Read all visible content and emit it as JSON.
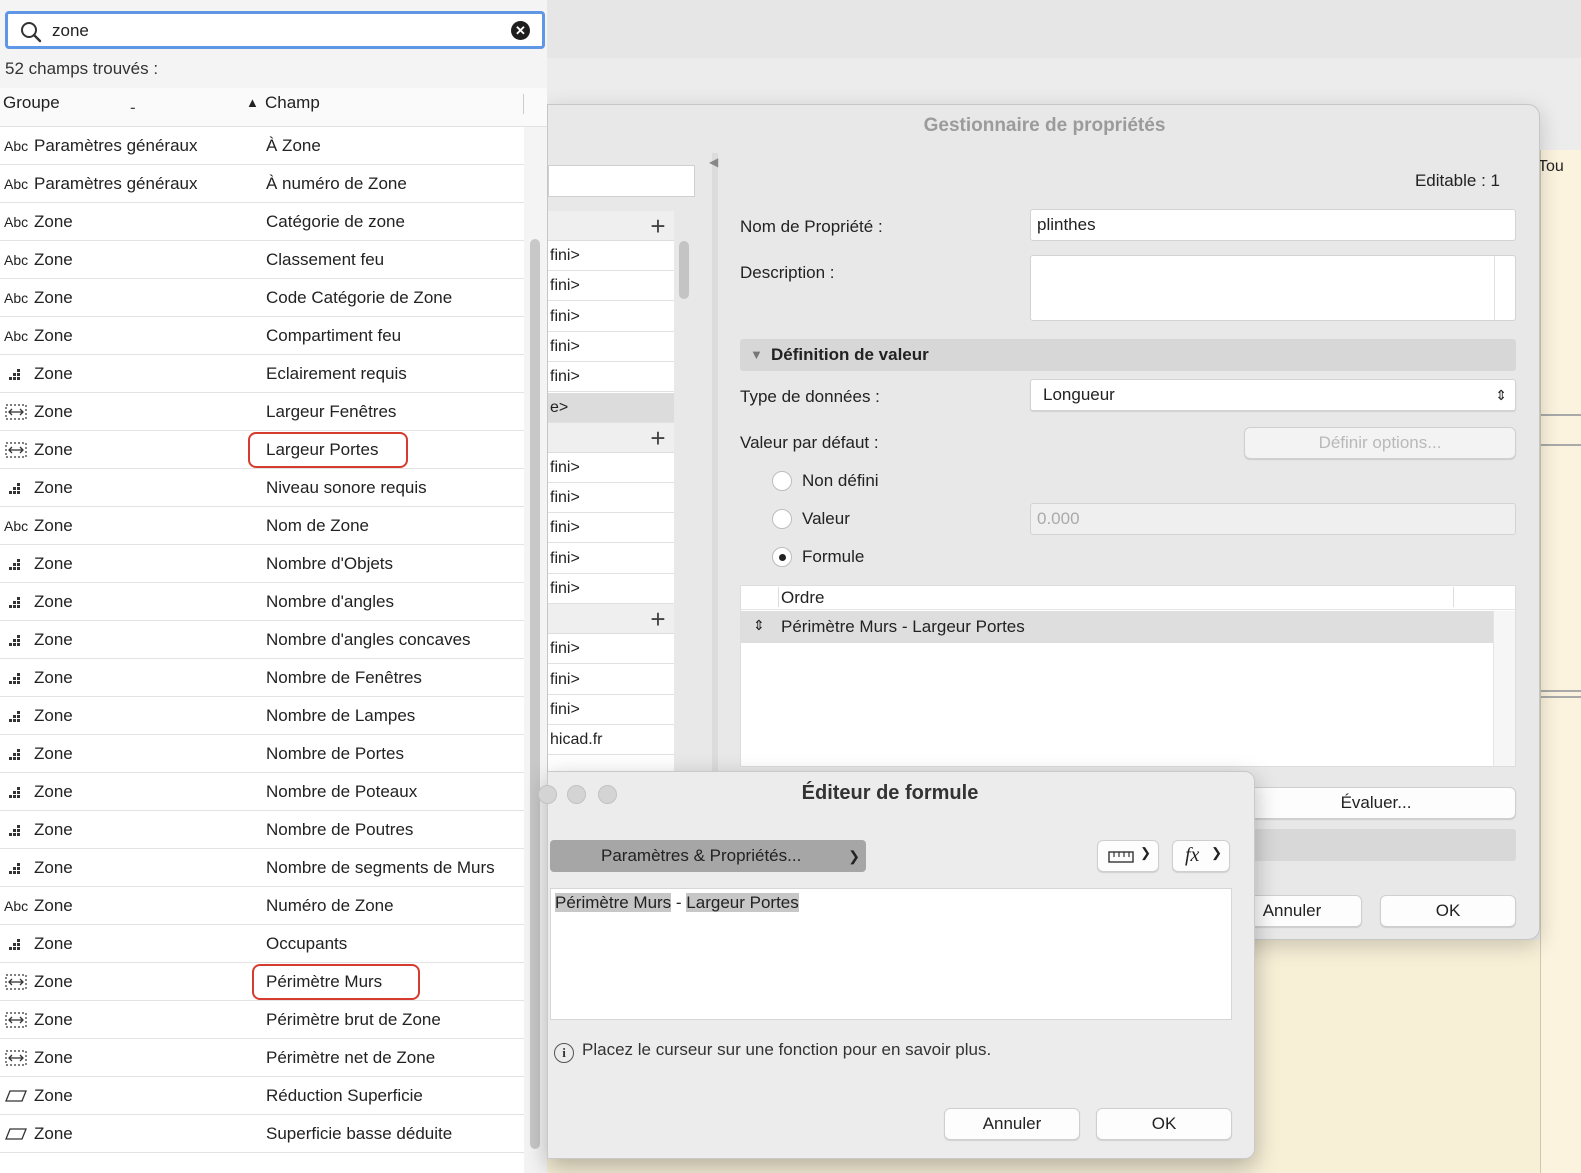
{
  "background": {
    "partial_label": "Tou"
  },
  "search_panel": {
    "search_value": "zone",
    "results_count": "52 champs trouvés :",
    "columns": {
      "group": "Groupe",
      "group_sub": "-",
      "field": "Champ",
      "sort": "▲"
    },
    "rows": [
      {
        "icon": "text",
        "group": "Paramètres généraux",
        "field": "À Zone"
      },
      {
        "icon": "text",
        "group": "Paramètres généraux",
        "field": "À numéro de Zone"
      },
      {
        "icon": "text",
        "group": "Zone",
        "field": "Catégorie de zone"
      },
      {
        "icon": "text",
        "group": "Zone",
        "field": "Classement feu"
      },
      {
        "icon": "text",
        "group": "Zone",
        "field": "Code Catégorie de Zone"
      },
      {
        "icon": "text",
        "group": "Zone",
        "field": "Compartiment feu"
      },
      {
        "icon": "number",
        "group": "Zone",
        "field": "Eclairement requis"
      },
      {
        "icon": "length",
        "group": "Zone",
        "field": "Largeur Fenêtres"
      },
      {
        "icon": "length",
        "group": "Zone",
        "field": "Largeur Portes",
        "highlight": true
      },
      {
        "icon": "number",
        "group": "Zone",
        "field": "Niveau sonore requis"
      },
      {
        "icon": "text",
        "group": "Zone",
        "field": "Nom de Zone"
      },
      {
        "icon": "number",
        "group": "Zone",
        "field": "Nombre d'Objets"
      },
      {
        "icon": "number",
        "group": "Zone",
        "field": "Nombre d'angles"
      },
      {
        "icon": "number",
        "group": "Zone",
        "field": "Nombre d'angles concaves"
      },
      {
        "icon": "number",
        "group": "Zone",
        "field": "Nombre de Fenêtres"
      },
      {
        "icon": "number",
        "group": "Zone",
        "field": "Nombre de Lampes"
      },
      {
        "icon": "number",
        "group": "Zone",
        "field": "Nombre de Portes"
      },
      {
        "icon": "number",
        "group": "Zone",
        "field": "Nombre de Poteaux"
      },
      {
        "icon": "number",
        "group": "Zone",
        "field": "Nombre de Poutres"
      },
      {
        "icon": "number",
        "group": "Zone",
        "field": "Nombre de segments de Murs"
      },
      {
        "icon": "text",
        "group": "Zone",
        "field": "Numéro de Zone"
      },
      {
        "icon": "number",
        "group": "Zone",
        "field": "Occupants"
      },
      {
        "icon": "length",
        "group": "Zone",
        "field": "Périmètre Murs",
        "highlight": true
      },
      {
        "icon": "length",
        "group": "Zone",
        "field": "Périmètre brut de Zone"
      },
      {
        "icon": "length",
        "group": "Zone",
        "field": "Périmètre net de Zone"
      },
      {
        "icon": "area",
        "group": "Zone",
        "field": "Réduction Superficie"
      },
      {
        "icon": "area",
        "group": "Zone",
        "field": "Superficie basse déduite"
      }
    ]
  },
  "property_manager": {
    "title": "Gestionnaire de propriétés",
    "editable": "Editable : 1",
    "left_list": [
      {
        "kind": "header"
      },
      {
        "kind": "item",
        "text": "fini>"
      },
      {
        "kind": "item",
        "text": "fini>"
      },
      {
        "kind": "item",
        "text": "fini>"
      },
      {
        "kind": "item",
        "text": "fini>"
      },
      {
        "kind": "item",
        "text": "fini>"
      },
      {
        "kind": "selected",
        "text": "e>"
      },
      {
        "kind": "header"
      },
      {
        "kind": "item",
        "text": "fini>"
      },
      {
        "kind": "item",
        "text": "fini>"
      },
      {
        "kind": "item",
        "text": "fini>"
      },
      {
        "kind": "item",
        "text": "fini>"
      },
      {
        "kind": "item",
        "text": "fini>"
      },
      {
        "kind": "header"
      },
      {
        "kind": "item",
        "text": "fini>"
      },
      {
        "kind": "item",
        "text": "fini>"
      },
      {
        "kind": "item",
        "text": "fini>"
      },
      {
        "kind": "item",
        "text": "hicad.fr"
      }
    ],
    "name_label": "Nom de Propriété :",
    "name_value": "plinthes",
    "description_label": "Description :",
    "section_label": "Définition de valeur",
    "data_type_label": "Type de données :",
    "data_type_value": "Longueur",
    "default_value_label": "Valeur par défaut :",
    "define_options": "Définir options...",
    "radio_undefined": "Non défini",
    "radio_value": "Valeur",
    "value_placeholder": "0.000",
    "radio_formula": "Formule",
    "order_header": "Ordre",
    "order_row": "Périmètre Murs - Largeur Portes",
    "evaluate": "Évaluer...",
    "cancel": "Annuler",
    "ok": "OK"
  },
  "formula_editor": {
    "title": "Éditeur de formule",
    "params_button": "Paramètres & Propriétés...",
    "formula_tokens": [
      "Périmètre Murs",
      " - ",
      "Largeur Portes"
    ],
    "hint": "Placez le curseur sur une fonction pour en savoir plus.",
    "cancel": "Annuler",
    "ok": "OK"
  }
}
